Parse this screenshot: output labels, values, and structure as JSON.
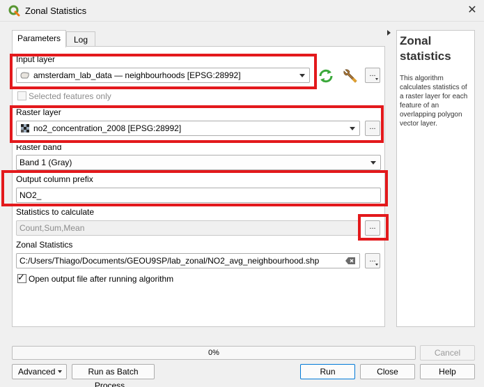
{
  "window": {
    "title": "Zonal Statistics",
    "app_icon": "qgis-icon",
    "close_icon": "close-icon"
  },
  "tabs": [
    {
      "label": "Parameters",
      "active": true
    },
    {
      "label": "Log",
      "active": false
    }
  ],
  "params": {
    "input_layer": {
      "label": "Input layer",
      "value": "amsterdam_lab_data — neighbourhoods [EPSG:28992]",
      "selected_features_label": "Selected features only",
      "selected_features_checked": false
    },
    "raster_layer": {
      "label": "Raster layer",
      "value": "no2_concentration_2008 [EPSG:28992]"
    },
    "raster_band": {
      "label": "Raster band",
      "value": "Band 1 (Gray)"
    },
    "output_prefix": {
      "label": "Output column prefix",
      "value": "NO2_"
    },
    "statistics": {
      "label": "Statistics to calculate",
      "value": "Count,Sum,Mean"
    },
    "output": {
      "label": "Zonal Statistics",
      "value": "C:/Users/Thiago/Documents/GEOU9SP/lab_zonal/NO2_avg_neighbourhood.shp"
    },
    "open_output": {
      "label": "Open output file after running algorithm",
      "checked": true
    },
    "dots": "..."
  },
  "help": {
    "title": "Zonal statistics",
    "text": "This algorithm calculates statistics of a raster layer for each feature of an overlapping polygon vector layer."
  },
  "progress": {
    "text": "0%",
    "value": 0
  },
  "buttons": {
    "cancel": "Cancel",
    "advanced": "Advanced",
    "batch": "Run as Batch Process...",
    "run": "Run",
    "close": "Close",
    "help": "Help"
  },
  "colors": {
    "highlight": "#e3191c",
    "accent": "#0078d7",
    "qgis_green": "#589632",
    "qgis_yellow": "#ee7913"
  }
}
